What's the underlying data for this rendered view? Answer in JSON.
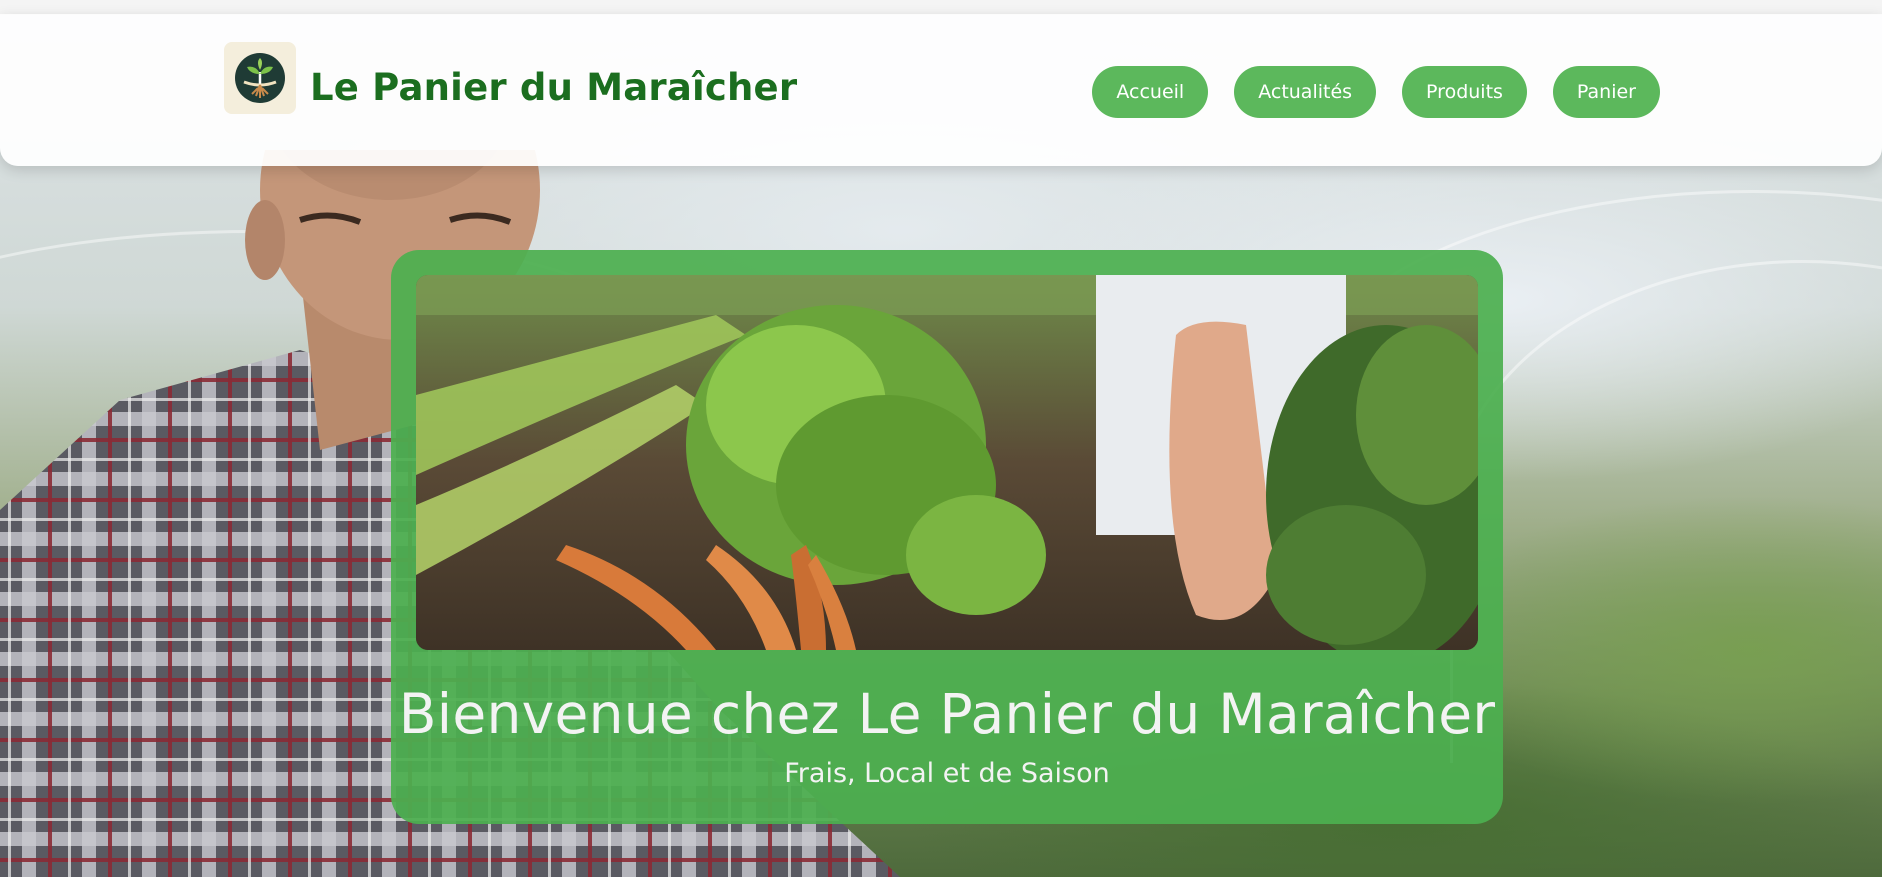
{
  "header": {
    "brand": "Le Panier du Maraîcher",
    "logo_icon": "sprout-icon",
    "nav": [
      {
        "label": "Accueil"
      },
      {
        "label": "Actualités"
      },
      {
        "label": "Produits"
      },
      {
        "label": "Panier"
      }
    ]
  },
  "hero": {
    "title": "Bienvenue chez Le Panier du Maraîcher",
    "subtitle": "Frais, Local et de Saison"
  },
  "colors": {
    "brand_green": "#1b6e1f",
    "button_green": "#5cb85c",
    "hero_green": "#4caf50",
    "logo_bg": "#f4eedc",
    "logo_circle": "#1f3b35"
  }
}
